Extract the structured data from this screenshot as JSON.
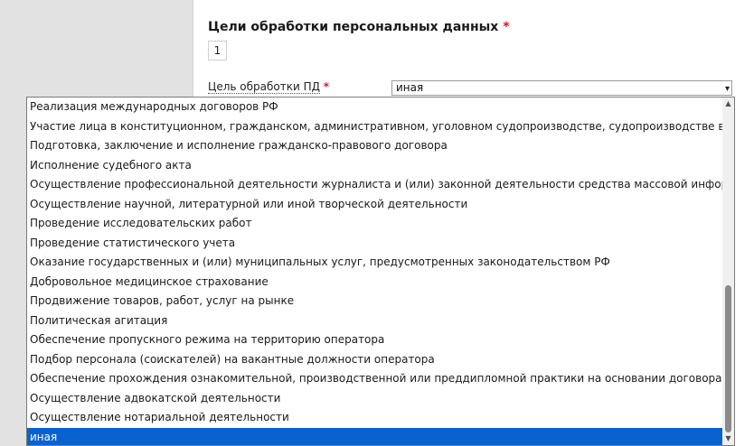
{
  "section": {
    "title": "Цели обработки персональных данных",
    "required_mark": "*",
    "counter": "1"
  },
  "field": {
    "label": "Цель обработки ПД",
    "required_mark": "*",
    "value": "иная",
    "arrow": "▾"
  },
  "dropdown": {
    "options": [
      "Реализация международных договоров РФ",
      "Участие лица в конституционном, гражданском, административном, уголовном судопроизводстве, судопроизводстве в арбитражных судах",
      "Подготовка, заключение и исполнение гражданско-правового договора",
      "Исполнение судебного акта",
      "Осуществление профессиональной деятельности журналиста и (или) законной деятельности средства массовой информации",
      "Осуществление научной, литературной или иной творческой деятельности",
      "Проведение исследовательских работ",
      "Проведение статистического учета",
      "Оказание государственных и (или) муниципальных услуг, предусмотренных законодательством РФ",
      "Добровольное медицинское страхование",
      "Продвижение товаров, работ, услуг на рынке",
      "Политическая агитация",
      "Обеспечение пропускного режима на территорию оператора",
      "Подбор персонала (соискателей) на вакантные должности оператора",
      "Обеспечение прохождения ознакомительной, производственной или преддипломной практики на основании договора с учебным заведением",
      "Осуществление адвокатской деятельности",
      "Осуществление нотариальной деятельности",
      "иная"
    ],
    "selected_index": 17,
    "selected_color": "#0a62d0",
    "scroll_up_icon": "▲",
    "scroll_down_icon": "▼"
  }
}
